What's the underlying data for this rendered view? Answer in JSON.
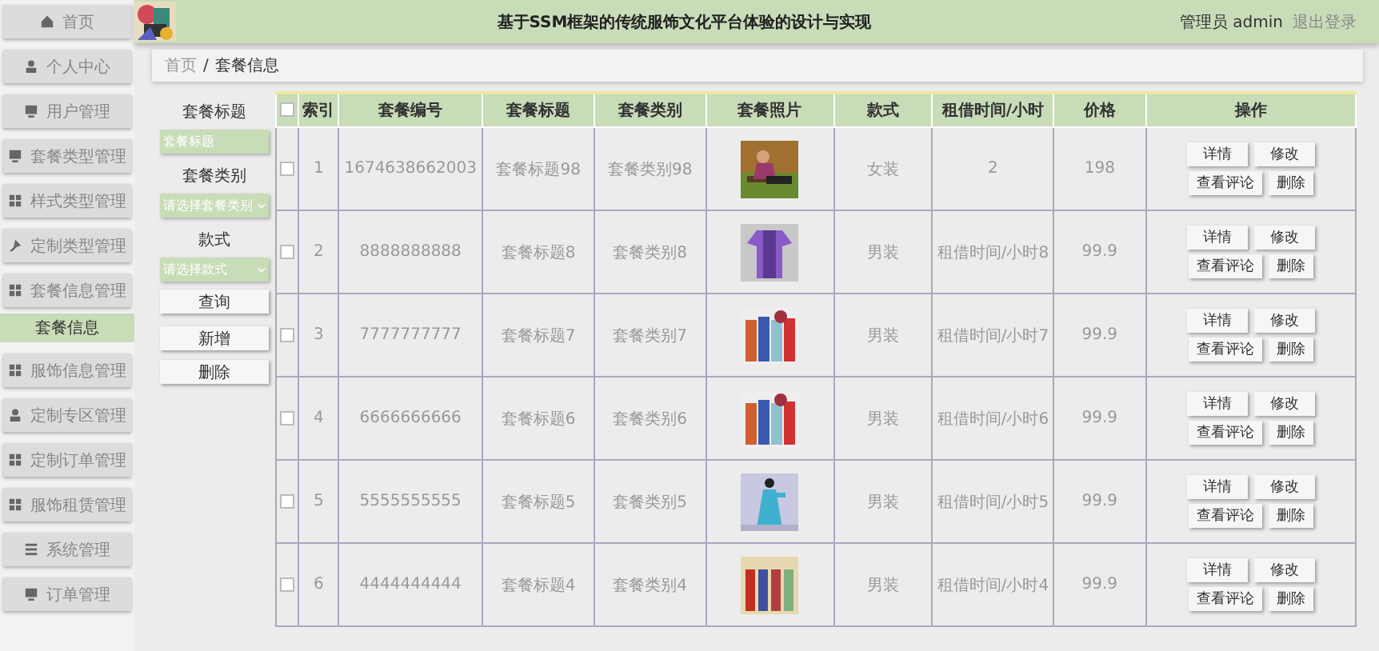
{
  "header": {
    "title": "基于SSM框架的传统服饰文化平台体验的设计与实现",
    "user_role": "管理员",
    "user_name": "admin",
    "logout": "退出登录"
  },
  "sidebar": {
    "items": [
      {
        "label": "首页",
        "selected": false
      },
      {
        "label": "个人中心",
        "selected": false
      },
      {
        "label": "用户管理",
        "selected": false
      },
      {
        "label": "套餐类型管理",
        "selected": false
      },
      {
        "label": "样式类型管理",
        "selected": false
      },
      {
        "label": "定制类型管理",
        "selected": false
      },
      {
        "label": "套餐信息管理",
        "selected": false,
        "children": [
          {
            "label": "套餐信息",
            "selected": true
          }
        ]
      },
      {
        "label": "服饰信息管理",
        "selected": false
      },
      {
        "label": "定制专区管理",
        "selected": false
      },
      {
        "label": "定制订单管理",
        "selected": false
      },
      {
        "label": "服饰租赁管理",
        "selected": false
      },
      {
        "label": "系统管理",
        "selected": false
      },
      {
        "label": "订单管理",
        "selected": false
      }
    ]
  },
  "breadcrumb": {
    "items": [
      "首页",
      "套餐信息"
    ],
    "separator": "/"
  },
  "search": {
    "fields": [
      {
        "kind": "input",
        "label": "套餐标题",
        "placeholder": "套餐标题"
      },
      {
        "kind": "select",
        "label": "套餐类别",
        "placeholder": "请选择套餐类别"
      },
      {
        "kind": "select",
        "label": "款式",
        "placeholder": "请选择款式"
      }
    ],
    "query_button": "查询",
    "buttons": [
      "新增",
      "删除"
    ]
  },
  "table": {
    "select_all": {
      "checked": false
    },
    "columns": [
      "索引",
      "套餐编号",
      "套餐标题",
      "套餐类别",
      "套餐照片",
      "款式",
      "租借时间/小时",
      "价格",
      "操作"
    ],
    "rows": [
      {
        "checked": false,
        "index": "1",
        "code": "1674638662003",
        "title": "套餐标题98",
        "category": "套餐类别98",
        "style": "女装",
        "hours": "2",
        "price": "198",
        "actions": [
          "详情",
          "修改",
          "查看评论",
          "删除"
        ]
      },
      {
        "checked": false,
        "index": "2",
        "code": "8888888888",
        "title": "套餐标题8",
        "category": "套餐类别8",
        "style": "男装",
        "hours": "租借时间/小时8",
        "price": "99.9",
        "actions": [
          "详情",
          "修改",
          "查看评论",
          "删除"
        ]
      },
      {
        "checked": false,
        "index": "3",
        "code": "7777777777",
        "title": "套餐标题7",
        "category": "套餐类别7",
        "style": "男装",
        "hours": "租借时间/小时7",
        "price": "99.9",
        "actions": [
          "详情",
          "修改",
          "查看评论",
          "删除"
        ]
      },
      {
        "checked": false,
        "index": "4",
        "code": "6666666666",
        "title": "套餐标题6",
        "category": "套餐类别6",
        "style": "男装",
        "hours": "租借时间/小时6",
        "price": "99.9",
        "actions": [
          "详情",
          "修改",
          "查看评论",
          "删除"
        ]
      },
      {
        "checked": false,
        "index": "5",
        "code": "5555555555",
        "title": "套餐标题5",
        "category": "套餐类别5",
        "style": "男装",
        "hours": "租借时间/小时5",
        "price": "99.9",
        "actions": [
          "详情",
          "修改",
          "查看评论",
          "删除"
        ]
      },
      {
        "checked": false,
        "index": "6",
        "code": "4444444444",
        "title": "套餐标题4",
        "category": "套餐类别4",
        "style": "男装",
        "hours": "租借时间/小时4",
        "price": "99.9",
        "actions": [
          "详情",
          "修改",
          "查看评论",
          "删除"
        ]
      }
    ]
  }
}
